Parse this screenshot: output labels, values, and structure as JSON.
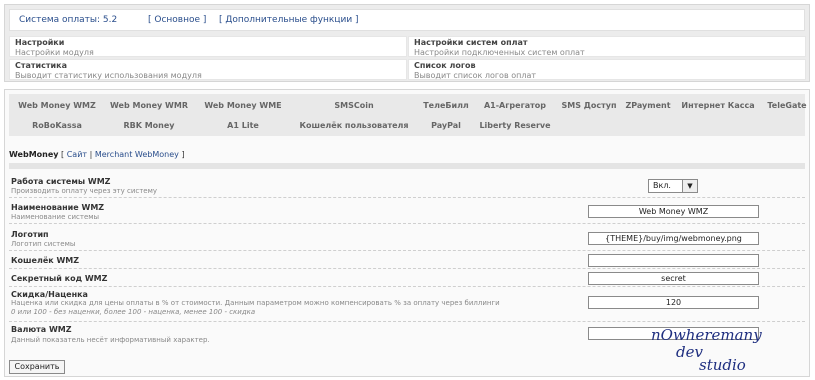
{
  "header": {
    "version_text": "Система оплаты: 5.2",
    "link_main": "[ Основное ]",
    "link_extra": "[ Дополнительные функции ]"
  },
  "modules": [
    {
      "title": "Настройки",
      "desc": "Настройки модуля"
    },
    {
      "title": "Настройки систем оплат",
      "desc": "Настройки подключенных систем оплат"
    },
    {
      "title": "Статистика",
      "desc": "Выводит статистику использования модуля"
    },
    {
      "title": "Список логов",
      "desc": "Выводит список логов оплат"
    }
  ],
  "tabs_row1": [
    "Web Money WMZ",
    "Web Money WMR",
    "Web Money WME",
    "SMSCoin",
    "ТелеБилл",
    "A1-Агрегатор",
    "SMS Доступ",
    "ZPayment",
    "Интернет Касса",
    "TeleGate"
  ],
  "tabs_row2": [
    "RoBoKassa",
    "RBK Money",
    "A1 Lite",
    "Кошелёк пользователя",
    "PayPal",
    "Liberty Reserve"
  ],
  "section": {
    "name": "WebMoney",
    "open": "[",
    "link_site": "Сайт",
    "sep": "|",
    "link_merchant": "Merchant WebMoney",
    "close": "]"
  },
  "settings": {
    "status": {
      "title": "Работа системы WMZ",
      "desc": "Производить оплату через эту систему",
      "value": "Вкл.",
      "arrow": "▼"
    },
    "name": {
      "title": "Наименование WMZ",
      "desc": "Наименование системы",
      "value": "Web  Money WMZ"
    },
    "logo": {
      "title": "Логотип",
      "desc": "Логотип системы",
      "value": "{THEME}/buy/img/webmoney.png"
    },
    "wallet": {
      "title": "Кошелёк WMZ",
      "value": ""
    },
    "secret": {
      "title": "Секретный код WMZ",
      "value": "secret"
    },
    "markup": {
      "title": "Скидка/Наценка",
      "desc1": "Наценка или скидка для цены оплаты в % от стоимости. Данным параметром можно компенсировать % за оплату через биллинги",
      "desc2": "0 или 100 - без наценки, более 100 - наценка, менее 100 - скидка",
      "value": "120"
    },
    "currency": {
      "title": "Валюта WMZ",
      "desc": "Данный показатель несёт информативный характер.",
      "value": ""
    }
  },
  "save_label": "Сохранить",
  "watermark": {
    "line1": "nOwheremany",
    "line2": "dev",
    "line3": "studio"
  }
}
